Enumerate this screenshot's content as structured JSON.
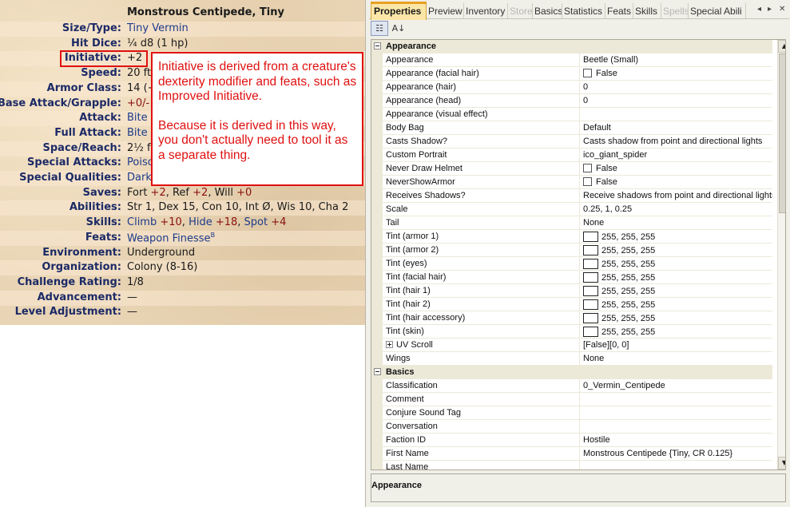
{
  "statblock": {
    "title": "Monstrous Centipede, Tiny",
    "rows": [
      {
        "label": "Size/Type:",
        "value": "Tiny Vermin"
      },
      {
        "label": "Hit Dice:",
        "value": "¼ d8 (1 hp)"
      },
      {
        "label": "Initiative:",
        "value": "+2"
      },
      {
        "label": "Speed:",
        "value": "20 ft."
      },
      {
        "label": "Armor Class:",
        "value": "14 (+"
      },
      {
        "label": "Base Attack/Grapple:",
        "value": "+0/-"
      },
      {
        "label": "Attack:",
        "value": "Bite"
      },
      {
        "label": "Full Attack:",
        "value": "Bite"
      },
      {
        "label": "Space/Reach:",
        "value": "2½ f"
      },
      {
        "label": "Special Attacks:",
        "value": "Poiso"
      },
      {
        "label": "Special Qualities:",
        "value": "Dark"
      },
      {
        "label": "Saves:",
        "value": "Fort +2, Ref +2, Will +0"
      },
      {
        "label": "Abilities:",
        "value": "Str 1, Dex 15, Con 10, Int Ø, Wis 10, Cha 2"
      },
      {
        "label": "Skills:",
        "value": "Climb +10, Hide +18, Spot +4"
      },
      {
        "label": "Feats:",
        "value": "Weapon Finesse"
      },
      {
        "label": "Environment:",
        "value": "Underground"
      },
      {
        "label": "Organization:",
        "value": "Colony (8-16)"
      },
      {
        "label": "Challenge Rating:",
        "value": "1/8"
      },
      {
        "label": "Advancement:",
        "value": "—"
      },
      {
        "label": "Level Adjustment:",
        "value": "—"
      }
    ],
    "saves_parts": {
      "fort": "Fort ",
      "fort_mod": "+2",
      "ref": ", Ref ",
      "ref_mod": "+2",
      "will": ", Will ",
      "will_mod": "+0"
    },
    "skills_parts": {
      "climb": "Climb",
      "climb_mod": " +10",
      "sep1": ", ",
      "hide": "Hide",
      "hide_mod": " +18",
      "sep2": ", ",
      "spot": "Spot",
      "spot_mod": " +4"
    },
    "feat_superscript": "B"
  },
  "callout": {
    "para1": "Initiative is derived from a creature's dexterity modifier and feats, such as Improved Initiative.",
    "para2": "Because it is derived in this way, you don't actually need to tool it as a separate thing."
  },
  "tabs": [
    {
      "label": "Properties",
      "state": "active"
    },
    {
      "label": "Preview",
      "state": "normal"
    },
    {
      "label": "Inventory",
      "state": "normal"
    },
    {
      "label": "Store",
      "state": "disabled"
    },
    {
      "label": "Basics",
      "state": "normal"
    },
    {
      "label": "Statistics",
      "state": "normal"
    },
    {
      "label": "Feats",
      "state": "normal"
    },
    {
      "label": "Skills",
      "state": "normal"
    },
    {
      "label": "Spells",
      "state": "disabled"
    },
    {
      "label": "Special Abili",
      "state": "normal"
    }
  ],
  "tab_scroll": {
    "left": "◂",
    "right": "▸",
    "close": "✕"
  },
  "toolbar": {
    "categorized_glyph": "☷",
    "alphabetical_glyph": "A↓"
  },
  "grid": {
    "categories": [
      {
        "name": "Appearance",
        "rows": [
          {
            "name": "Appearance",
            "value": "Beetle (Small)"
          },
          {
            "name": "Appearance (facial hair)",
            "value": "False",
            "kind": "checkbox"
          },
          {
            "name": "Appearance (hair)",
            "value": "0"
          },
          {
            "name": "Appearance (head)",
            "value": "0"
          },
          {
            "name": "Appearance (visual effect)",
            "value": ""
          },
          {
            "name": "Body Bag",
            "value": "Default"
          },
          {
            "name": "Casts Shadow?",
            "value": "Casts shadow from point and directional lights"
          },
          {
            "name": "Custom Portrait",
            "value": "ico_giant_spider"
          },
          {
            "name": "Never Draw Helmet",
            "value": "False",
            "kind": "checkbox"
          },
          {
            "name": "NeverShowArmor",
            "value": "False",
            "kind": "checkbox"
          },
          {
            "name": "Receives Shadows?",
            "value": "Receive shadows from point and directional lights"
          },
          {
            "name": "Scale",
            "value": "0.25, 1, 0.25"
          },
          {
            "name": "Tail",
            "value": "None"
          },
          {
            "name": "Tint (armor 1)",
            "value": "255, 255, 255",
            "kind": "color",
            "color": "#ffffff"
          },
          {
            "name": "Tint (armor 2)",
            "value": "255, 255, 255",
            "kind": "color",
            "color": "#ffffff"
          },
          {
            "name": "Tint (eyes)",
            "value": "255, 255, 255",
            "kind": "color",
            "color": "#ffffff"
          },
          {
            "name": "Tint (facial hair)",
            "value": "255, 255, 255",
            "kind": "color",
            "color": "#ffffff"
          },
          {
            "name": "Tint (hair 1)",
            "value": "255, 255, 255",
            "kind": "color",
            "color": "#ffffff"
          },
          {
            "name": "Tint (hair 2)",
            "value": "255, 255, 255",
            "kind": "color",
            "color": "#ffffff"
          },
          {
            "name": "Tint (hair accessory)",
            "value": "255, 255, 255",
            "kind": "color",
            "color": "#ffffff"
          },
          {
            "name": "Tint (skin)",
            "value": "255, 255, 255",
            "kind": "color",
            "color": "#ffffff"
          },
          {
            "name": "UV Scroll",
            "value": "[False][0, 0]",
            "kind": "expandable"
          },
          {
            "name": "Wings",
            "value": "None"
          }
        ]
      },
      {
        "name": "Basics",
        "rows": [
          {
            "name": "Classification",
            "value": "0_Vermin_Centipede"
          },
          {
            "name": "Comment",
            "value": ""
          },
          {
            "name": "Conjure Sound Tag",
            "value": ""
          },
          {
            "name": "Conversation",
            "value": ""
          },
          {
            "name": "Faction ID",
            "value": "Hostile"
          },
          {
            "name": "First Name",
            "value": "Monstrous Centipede {Tiny, CR 0.125}"
          },
          {
            "name": "Last Name",
            "value": ""
          }
        ]
      }
    ]
  },
  "scrollbar": {
    "up": "▲",
    "down": "▼"
  },
  "description": {
    "title": "Appearance"
  },
  "colors": {
    "accent_red": "#e01010",
    "tab_active": "#fbe6a8",
    "label_blue": "#1c2a66",
    "mod_red": "#8a1010"
  }
}
